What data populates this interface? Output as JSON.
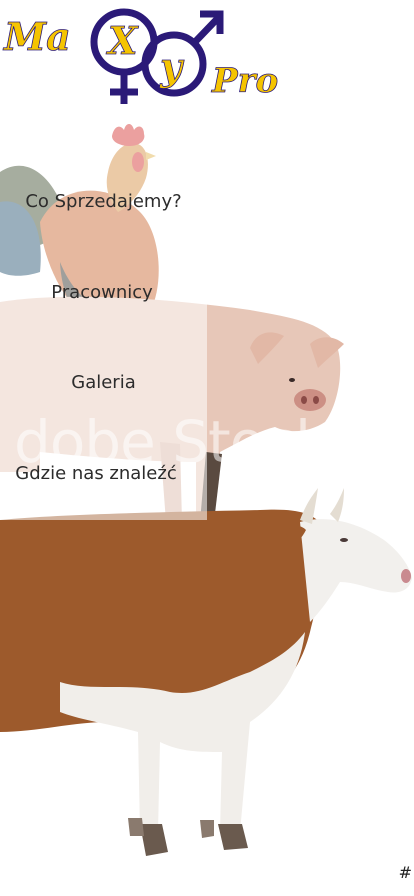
{
  "brand": {
    "part1": "Ma",
    "part2": "X",
    "part3": "y",
    "part4": "Pro",
    "colors": {
      "yellow": "#f5c400",
      "navy": "#2b1a78"
    }
  },
  "nav": {
    "items": [
      {
        "label": "Co Sprzedajemy?"
      },
      {
        "label": "Pracownicy"
      },
      {
        "label": "Galeria"
      },
      {
        "label": "Gdzie nas znaleźć"
      }
    ]
  },
  "watermark": {
    "text": "dobe Stock"
  },
  "corner": {
    "text": "#"
  },
  "illustrations": {
    "animals": [
      "rooster-icon",
      "pig-icon",
      "cow-icon"
    ]
  }
}
